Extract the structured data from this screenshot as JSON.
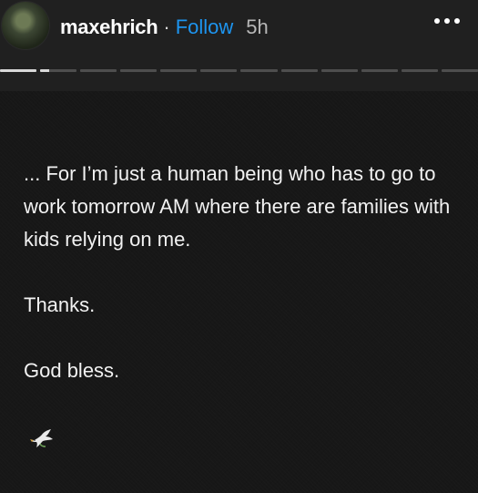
{
  "header": {
    "username": "maxehrich",
    "separator": "·",
    "follow_label": "Follow",
    "time_ago": "5h",
    "more_icon": "more-horizontal-icon"
  },
  "progress": {
    "segment_count": 12,
    "completed_segments": 1,
    "current_segment_fill": 0.25
  },
  "post": {
    "paragraphs": [
      "... For I’m just a human being who has to go to work tomorrow AM where there are families with kids relying on me.",
      "Thanks.",
      "God bless."
    ],
    "emoji_icon": "dove-icon"
  },
  "colors": {
    "follow": "#1d95f0",
    "background": "#171717",
    "header": "#202020"
  }
}
